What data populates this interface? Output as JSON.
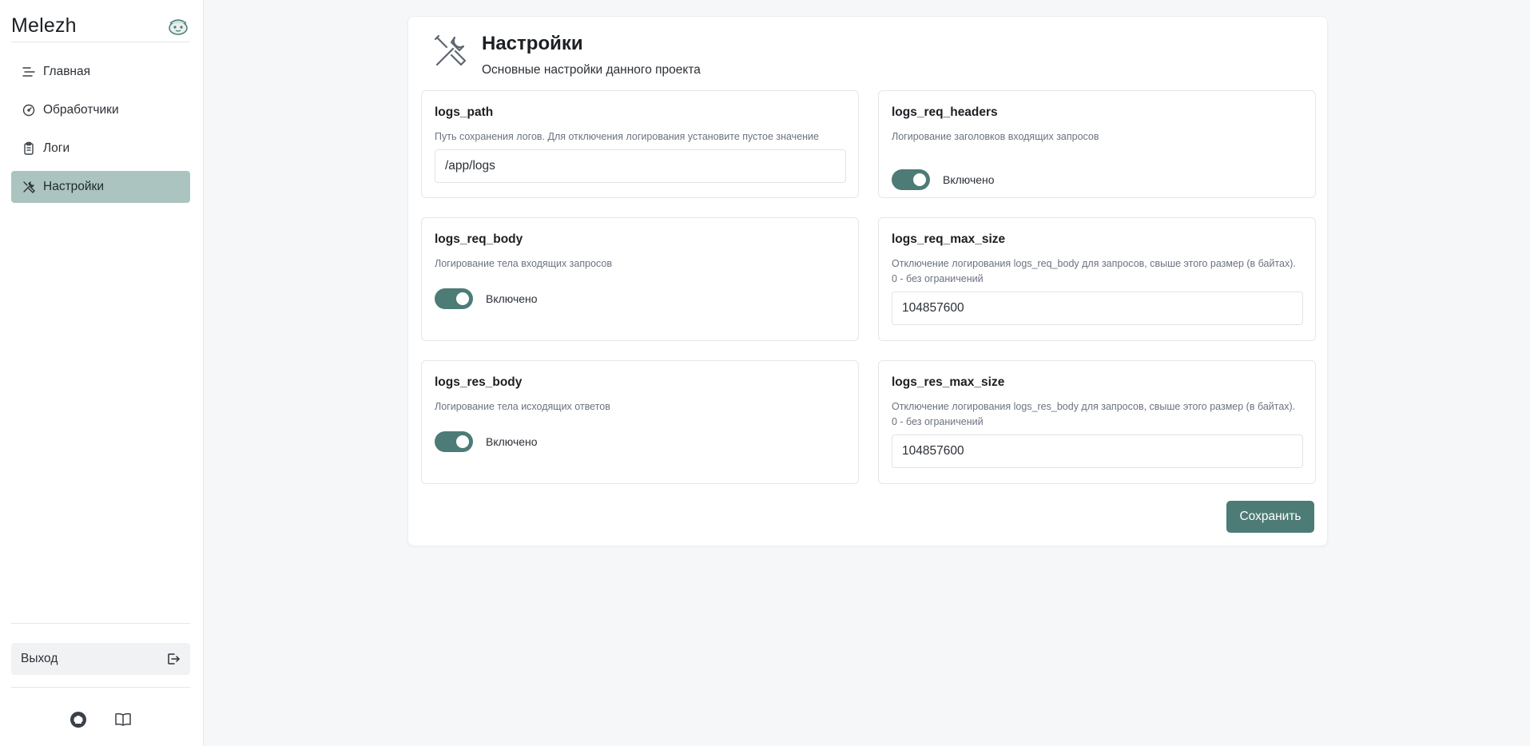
{
  "app": {
    "name": "Melezh",
    "logo_icon": "teapot-logo-icon"
  },
  "sidebar": {
    "items": [
      {
        "label": "Главная",
        "icon": "menu-lines-icon",
        "active": false
      },
      {
        "label": "Обработчики",
        "icon": "gauge-icon",
        "active": false
      },
      {
        "label": "Логи",
        "icon": "clipboard-icon",
        "active": false
      },
      {
        "label": "Настройки",
        "icon": "tools-icon",
        "active": true
      }
    ],
    "logout_label": "Выход",
    "footer_icons": [
      "github-icon",
      "book-icon"
    ]
  },
  "page": {
    "title": "Настройки",
    "subtitle": "Основные настройки данного проекта",
    "icon": "tools-icon"
  },
  "fields": {
    "logs_path": {
      "name": "logs_path",
      "description": "Путь сохранения логов. Для отключения логирования установите пустое значение",
      "value": "/app/logs"
    },
    "logs_req_headers": {
      "name": "logs_req_headers",
      "description": "Логирование заголовков входящих запросов",
      "toggle_label": "Включено",
      "enabled": true
    },
    "logs_req_body": {
      "name": "logs_req_body",
      "description": "Логирование тела входящих запросов",
      "toggle_label": "Включено",
      "enabled": true
    },
    "logs_req_max_size": {
      "name": "logs_req_max_size",
      "description": "Отключение логирования logs_req_body для запросов, свыше этого размер (в байтах). 0 - без ограничений",
      "value": "104857600"
    },
    "logs_res_body": {
      "name": "logs_res_body",
      "description": "Логирование тела исходящих ответов",
      "toggle_label": "Включено",
      "enabled": true
    },
    "logs_res_max_size": {
      "name": "logs_res_max_size",
      "description": "Отключение логирования logs_res_body для запросов, свыше этого размер (в байтах). 0 - без ограничений",
      "value": "104857600"
    }
  },
  "actions": {
    "save_label": "Сохранить"
  },
  "colors": {
    "accent": "#4d7b75",
    "nav_active": "#abc4c0",
    "background": "#f6f7f9"
  }
}
